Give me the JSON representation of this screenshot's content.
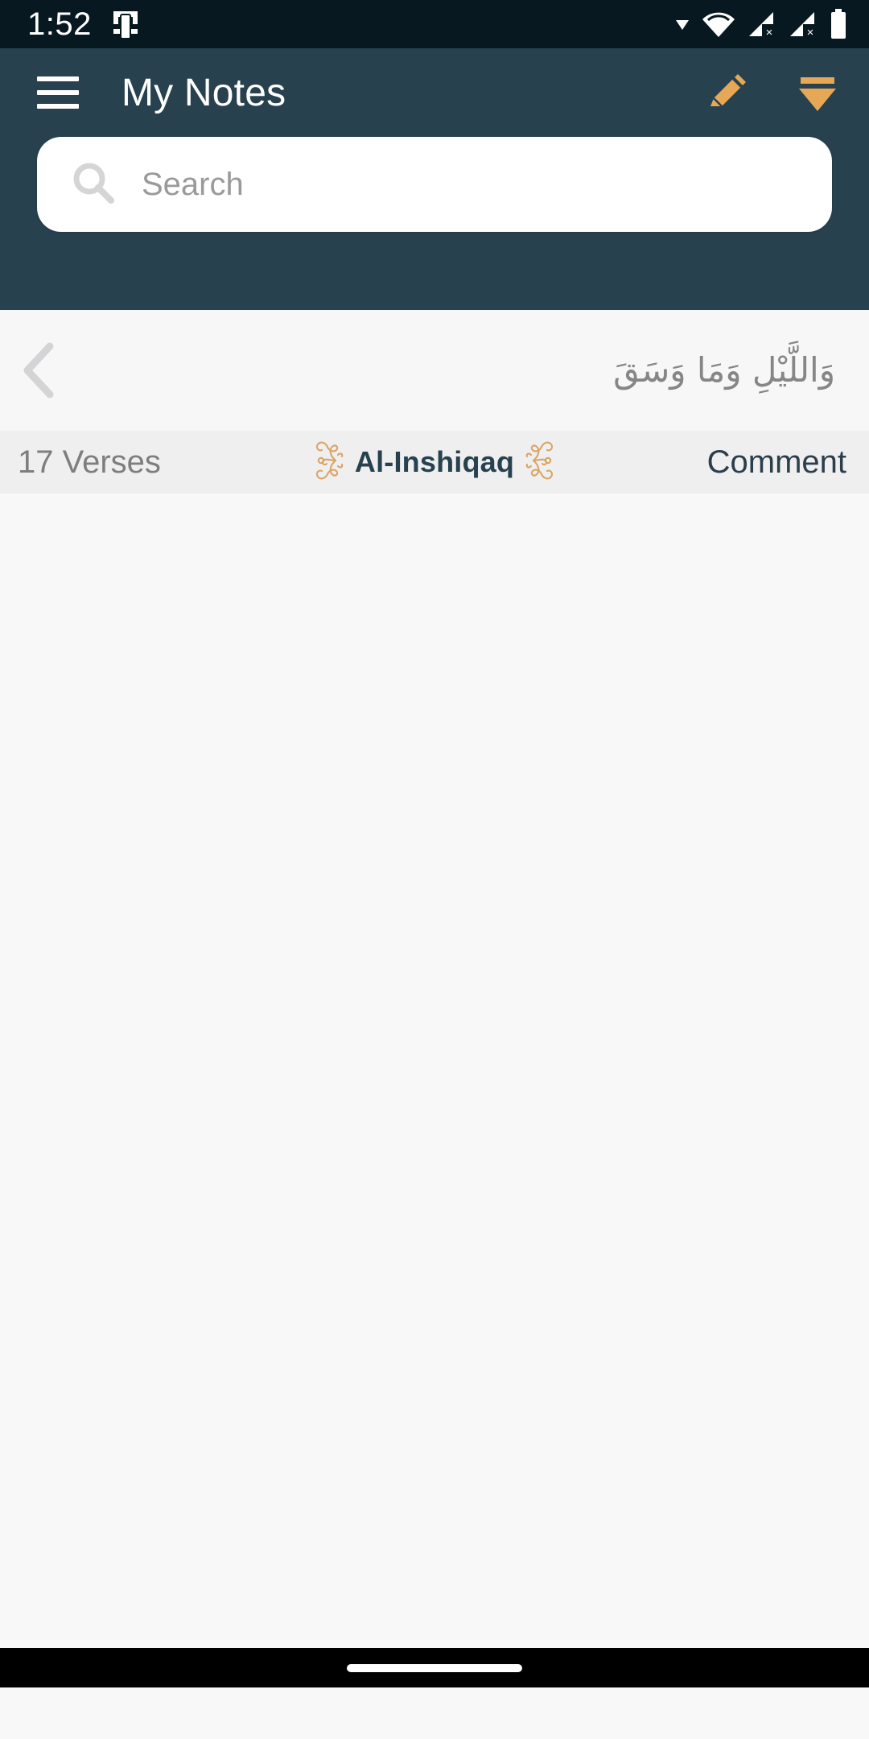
{
  "status_bar": {
    "time": "1:52",
    "icons": {
      "cast": "screen-cast-icon",
      "dropdown": "caret-down-icon",
      "wifi": "wifi-icon",
      "signal_1": "signal-no-sim-icon",
      "signal_2": "signal-no-sim-icon",
      "battery": "battery-full-icon"
    },
    "background": "#081821"
  },
  "toolbar": {
    "title": "My Notes",
    "menu_icon": "hamburger-menu-icon",
    "edit_icon": "pencil-edit-icon",
    "filter_icon": "filter-funnel-icon",
    "background": "#27414F",
    "accent": "#E6A757"
  },
  "search": {
    "placeholder": "Search",
    "value": "",
    "icon": "search-magnifier-icon"
  },
  "verse_row": {
    "back_icon": "chevron-left-icon",
    "arabic_text": "وَاللَّيْلِ وَمَا وَسَقَ",
    "background": "#F7F7F7"
  },
  "info_bar": {
    "verse_count": "17 Verses",
    "surah_name": "Al-Inshiqaq",
    "ornament_icon": "floral-ornament-icon",
    "comment_label": "Comment",
    "background": "#EFEFEF",
    "surah_color": "#27414F",
    "ornament_color": "#D9A566"
  },
  "content": {
    "items": [],
    "background": "#F8F8F8"
  },
  "nav_bar": {
    "gesture_pill": "home-gesture-pill",
    "background": "#000000"
  }
}
